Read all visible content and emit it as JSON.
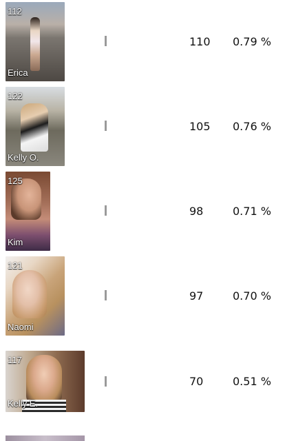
{
  "rows": [
    {
      "rank": "112",
      "name": "Erica",
      "votes": "110",
      "percent": "0.79 %",
      "share": 0.79
    },
    {
      "rank": "122",
      "name": "Kelly O.",
      "votes": "105",
      "percent": "0.76 %",
      "share": 0.76
    },
    {
      "rank": "125",
      "name": "Kim",
      "votes": "98",
      "percent": "0.71 %",
      "share": 0.71
    },
    {
      "rank": "121",
      "name": "Naomi",
      "votes": "97",
      "percent": "0.70 %",
      "share": 0.7
    },
    {
      "rank": "117",
      "name": "Kelly E.",
      "votes": "70",
      "percent": "0.51 %",
      "share": 0.51
    }
  ],
  "colors": {
    "bar": "#9a9a9a",
    "thumb_erica": "#8a7f78",
    "thumb_kelly_o": "#a9a39a",
    "thumb_kim": "#8e5b3e",
    "thumb_naomi": "#b7a186",
    "thumb_kelly_e": "#7a5a44"
  }
}
